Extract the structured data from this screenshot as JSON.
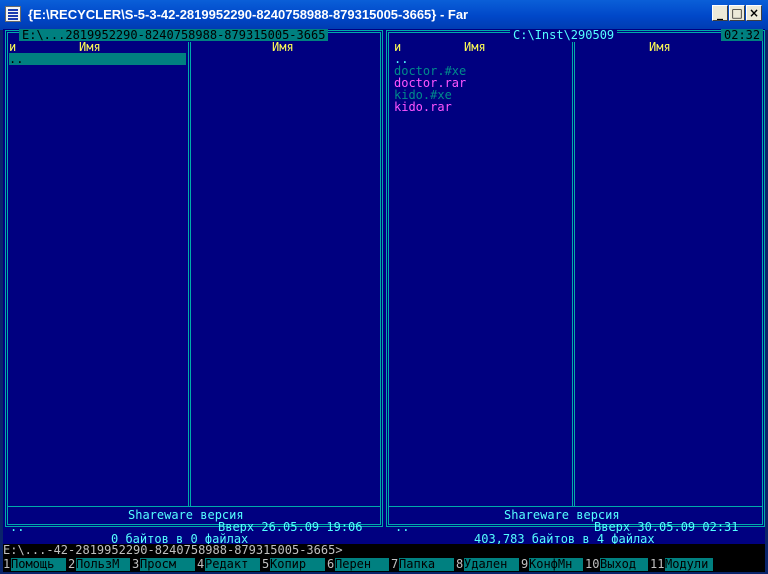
{
  "window": {
    "title": "{E:\\RECYCLER\\S-5-3-42-2819952290-8240758988-879315005-3665} - Far"
  },
  "left_panel": {
    "path": "E:\\...2819952290-8240758988-879315005-3665",
    "col1_header": "и",
    "col2_header": "Имя",
    "col3_header": "Имя",
    "items": [
      {
        "name": "..",
        "color": "#000000",
        "selected": true
      }
    ],
    "shareware": "Shareware версия",
    "status_name": "..",
    "status_info": "Вверх 26.05.09 19:06",
    "summary": "0 байтов в 0 файлах"
  },
  "right_panel": {
    "path": "C:\\Inst\\290509",
    "clock": "02:32",
    "col1_header": "и",
    "col2_header": "Имя",
    "col3_header": "Имя",
    "items": [
      {
        "name": "..",
        "color": "#55ffff"
      },
      {
        "name": "doctor.#xe",
        "color": "#008b8b"
      },
      {
        "name": "doctor.rar",
        "color": "#ff55ff"
      },
      {
        "name": "kido.#xe",
        "color": "#008b8b"
      },
      {
        "name": "kido.rar",
        "color": "#ff55ff"
      }
    ],
    "shareware": "Shareware версия",
    "status_name": "..",
    "status_info": "Вверх 30.05.09 02:31",
    "summary": "403,783 байтов в 4 файлах"
  },
  "command_line": "E:\\...-42-2819952290-8240758988-879315005-3665>",
  "keybar": [
    {
      "num": "1",
      "label": "Помощь"
    },
    {
      "num": "2",
      "label": "ПользМ"
    },
    {
      "num": "3",
      "label": "Просм"
    },
    {
      "num": "4",
      "label": "Редакт"
    },
    {
      "num": "5",
      "label": "Копир"
    },
    {
      "num": "6",
      "label": "Перен"
    },
    {
      "num": "7",
      "label": "Папка"
    },
    {
      "num": "8",
      "label": "Удален"
    },
    {
      "num": "9",
      "label": "КонфМн"
    },
    {
      "num": "10",
      "label": "Выход"
    },
    {
      "num": "11",
      "label": "Модули"
    }
  ],
  "colors": {
    "panel_bg": "#000080",
    "frame": "#00aaaa",
    "header": "#ffff55",
    "cursor": "#008080",
    "keybar_label": "#008080"
  }
}
